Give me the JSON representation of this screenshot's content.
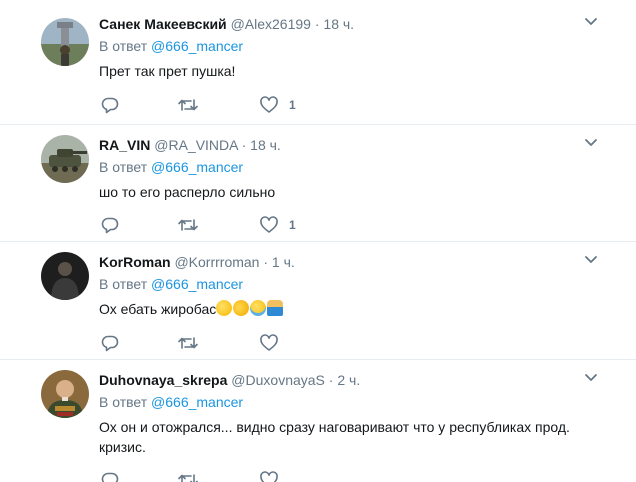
{
  "tweets": [
    {
      "name": "Санек Макеевский",
      "handle": "@Alex26199",
      "dot": "·",
      "time": "18 ч.",
      "reply_prefix": "В ответ",
      "reply_mention": "@666_mancer",
      "text": "Прет так прет пушка!",
      "like_count": "1"
    },
    {
      "name": "RA_VIN",
      "handle": "@RA_VINDA",
      "dot": "·",
      "time": "18 ч.",
      "reply_prefix": "В ответ",
      "reply_mention": "@666_mancer",
      "text": "шо то его расперло сильно",
      "like_count": "1"
    },
    {
      "name": "KorRoman",
      "handle": "@Korrrroman",
      "dot": "·",
      "time": "1 ч.",
      "reply_prefix": "В ответ",
      "reply_mention": "@666_mancer",
      "text": "Ох ебать жиробас",
      "emojis": [
        "sweat-smile-emoji",
        "rofl-emoji",
        "joy-emoji",
        "facepalm-emoji"
      ]
    },
    {
      "name": "Duhovnaya_skrepa",
      "handle": "@DuxovnayaS",
      "dot": "·",
      "time": "2 ч.",
      "reply_prefix": "В ответ",
      "reply_mention": "@666_mancer",
      "text": "Ох он и отожрался... видно сразу наговаривают что у республиках прод. кризис."
    }
  ],
  "icons": {
    "reply": "reply-icon",
    "retweet": "retweet-icon",
    "like": "like-icon",
    "more": "chevron-down-icon"
  },
  "colors": {
    "name": "#14171a",
    "secondary": "#657786",
    "mention": "#1b95e0",
    "divider": "#e6ecf0"
  }
}
